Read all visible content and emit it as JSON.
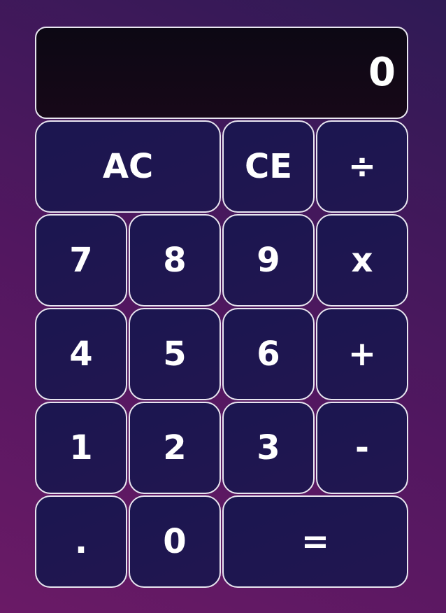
{
  "display": {
    "value": "0"
  },
  "keys": {
    "ac": "AC",
    "ce": "CE",
    "divide": "÷",
    "seven": "7",
    "eight": "8",
    "nine": "9",
    "multiply": "x",
    "four": "4",
    "five": "5",
    "six": "6",
    "plus": "+",
    "one": "1",
    "two": "2",
    "three": "3",
    "minus": "-",
    "decimal": ".",
    "zero": "0",
    "equals": "="
  }
}
